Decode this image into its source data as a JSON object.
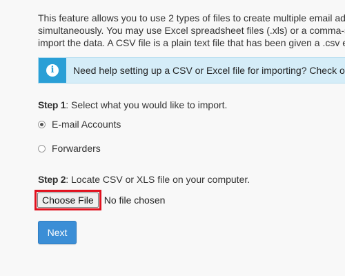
{
  "intro": {
    "lines": [
      "This feature allows you to use 2 types of files to create multiple email ad",
      "simultaneously. You may use Excel spreadsheet files (.xls) or a comma-s",
      "import the data. A CSV file is a plain text file that has been given a .csv e"
    ]
  },
  "callout": {
    "icon": "info-icon",
    "text": "Need help setting up a CSV or Excel file for importing? Check ou"
  },
  "step1": {
    "title_bold": "Step 1",
    "title_rest": ": Select what you would like to import.",
    "options": [
      {
        "label": "E-mail Accounts",
        "checked": true
      },
      {
        "label": "Forwarders",
        "checked": false
      }
    ]
  },
  "step2": {
    "title_bold": "Step 2",
    "title_rest": ": Locate CSV or XLS file on your computer.",
    "choose_label": "Choose File",
    "file_status": "No file chosen"
  },
  "actions": {
    "next_label": "Next"
  },
  "colors": {
    "accent": "#3b8ed6",
    "info_bg": "#d5edf8",
    "info_icon_bg": "#2a9fd6",
    "highlight": "#e0111e"
  }
}
